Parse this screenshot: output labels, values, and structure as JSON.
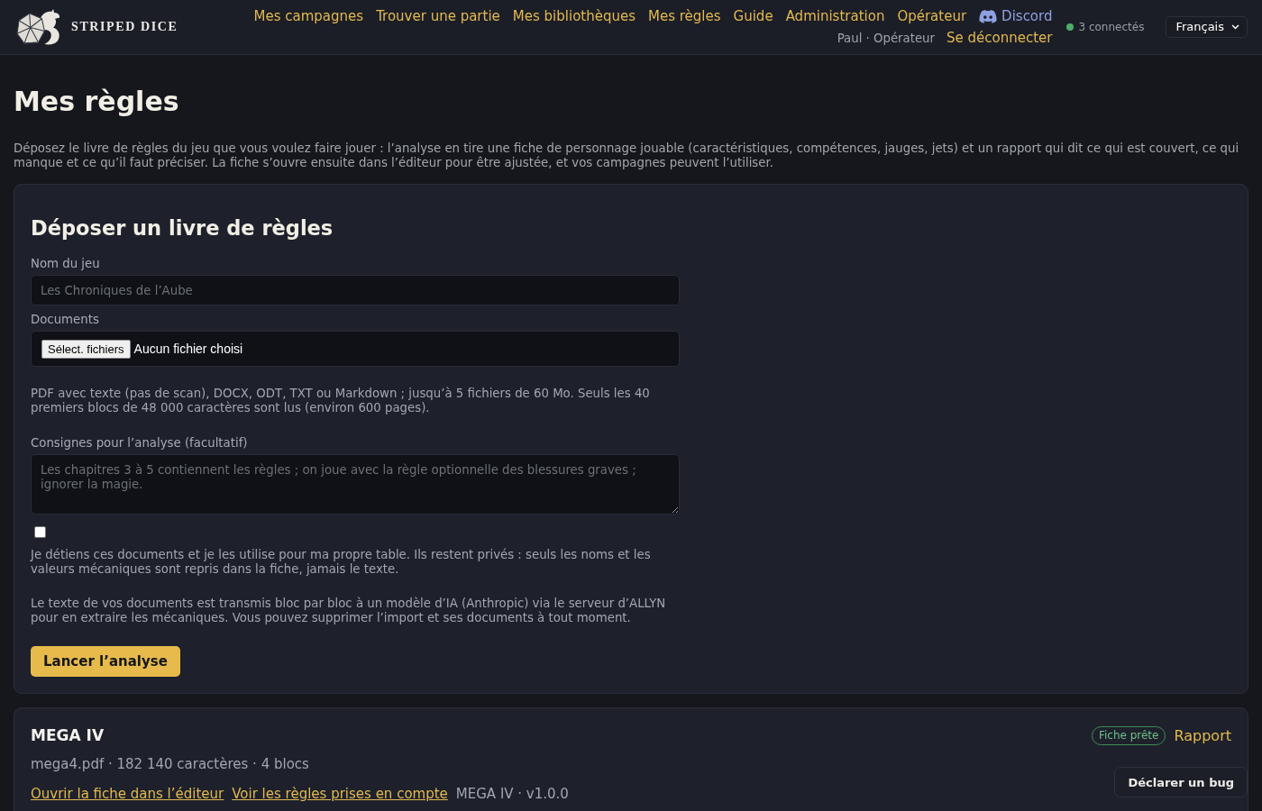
{
  "header": {
    "logo_text": "STRIPED DICE",
    "nav": [
      {
        "label": "Mes campagnes",
        "kind": "link"
      },
      {
        "label": "Trouver une partie",
        "kind": "link"
      },
      {
        "label": "Mes bibliothèques",
        "kind": "link"
      },
      {
        "label": "Mes règles",
        "kind": "link"
      },
      {
        "label": "Guide",
        "kind": "link"
      },
      {
        "label": "Administration",
        "kind": "link"
      },
      {
        "label": "Opérateur",
        "kind": "link"
      },
      {
        "label": "Discord",
        "kind": "discord"
      }
    ],
    "user": "Paul · Opérateur",
    "logout": "Se déconnecter",
    "online": "3 connectés",
    "language": "Français"
  },
  "page": {
    "title": "Mes règles",
    "intro": "Déposez le livre de règles du jeu que vous voulez faire jouer : l’analyse en tire une fiche de personnage jouable (caractéristiques, compétences, jauges, jets) et un rapport qui dit ce qui est couvert, ce qui manque et ce qu’il faut préciser. La fiche s’ouvre ensuite dans l’éditeur pour être ajustée, et vos campagnes peuvent l’utiliser."
  },
  "upload_form": {
    "title": "Déposer un livre de règles",
    "name_field": {
      "label": "Nom du jeu",
      "placeholder": "Les Chroniques de l’Aube"
    },
    "documents_field": {
      "label": "Documents",
      "button": "Sélect. fichiers",
      "status": "Aucun fichier choisi",
      "hint": "PDF avec texte (pas de scan), DOCX, ODT, TXT ou Markdown ; jusqu’à 5 fichiers de 60 Mo. Seuls les 40 premiers blocs de 48 000 caractères sont lus (environ 600 pages)."
    },
    "instructions_field": {
      "label": "Consignes pour l’analyse (facultatif)",
      "placeholder": "Les chapitres 3 à 5 contiennent les règles ; on joue avec la règle optionnelle des blessures graves ; ignorer la magie."
    },
    "consent": {
      "checked": false,
      "text": "Je détiens ces documents et je les utilise pour ma propre table. Ils restent privés : seuls les noms et les valeurs mécaniques sont repris dans la fiche, jamais le texte."
    },
    "notice": "Le texte de vos documents est transmis bloc par bloc à un modèle d’IA (Anthropic) via le serveur d’ALLYN pour en extraire les mécaniques. Vous pouvez supprimer l’import et ses documents à tout moment.",
    "submit": "Lancer l’analyse"
  },
  "imports": [
    {
      "title": "MEGA IV",
      "status": {
        "label": "Fiche prête",
        "kind": "ready"
      },
      "report_link": "Rapport",
      "meta": "mega4.pdf · 182 140 caractères · 4 blocs",
      "editor_link": "Ouvrir la fiche dans l’éditeur",
      "rules_link": "Voir les règles prises en compte",
      "version": "MEGA IV · v1.0.0"
    }
  ],
  "bug_button": "Déclarer un bug"
}
